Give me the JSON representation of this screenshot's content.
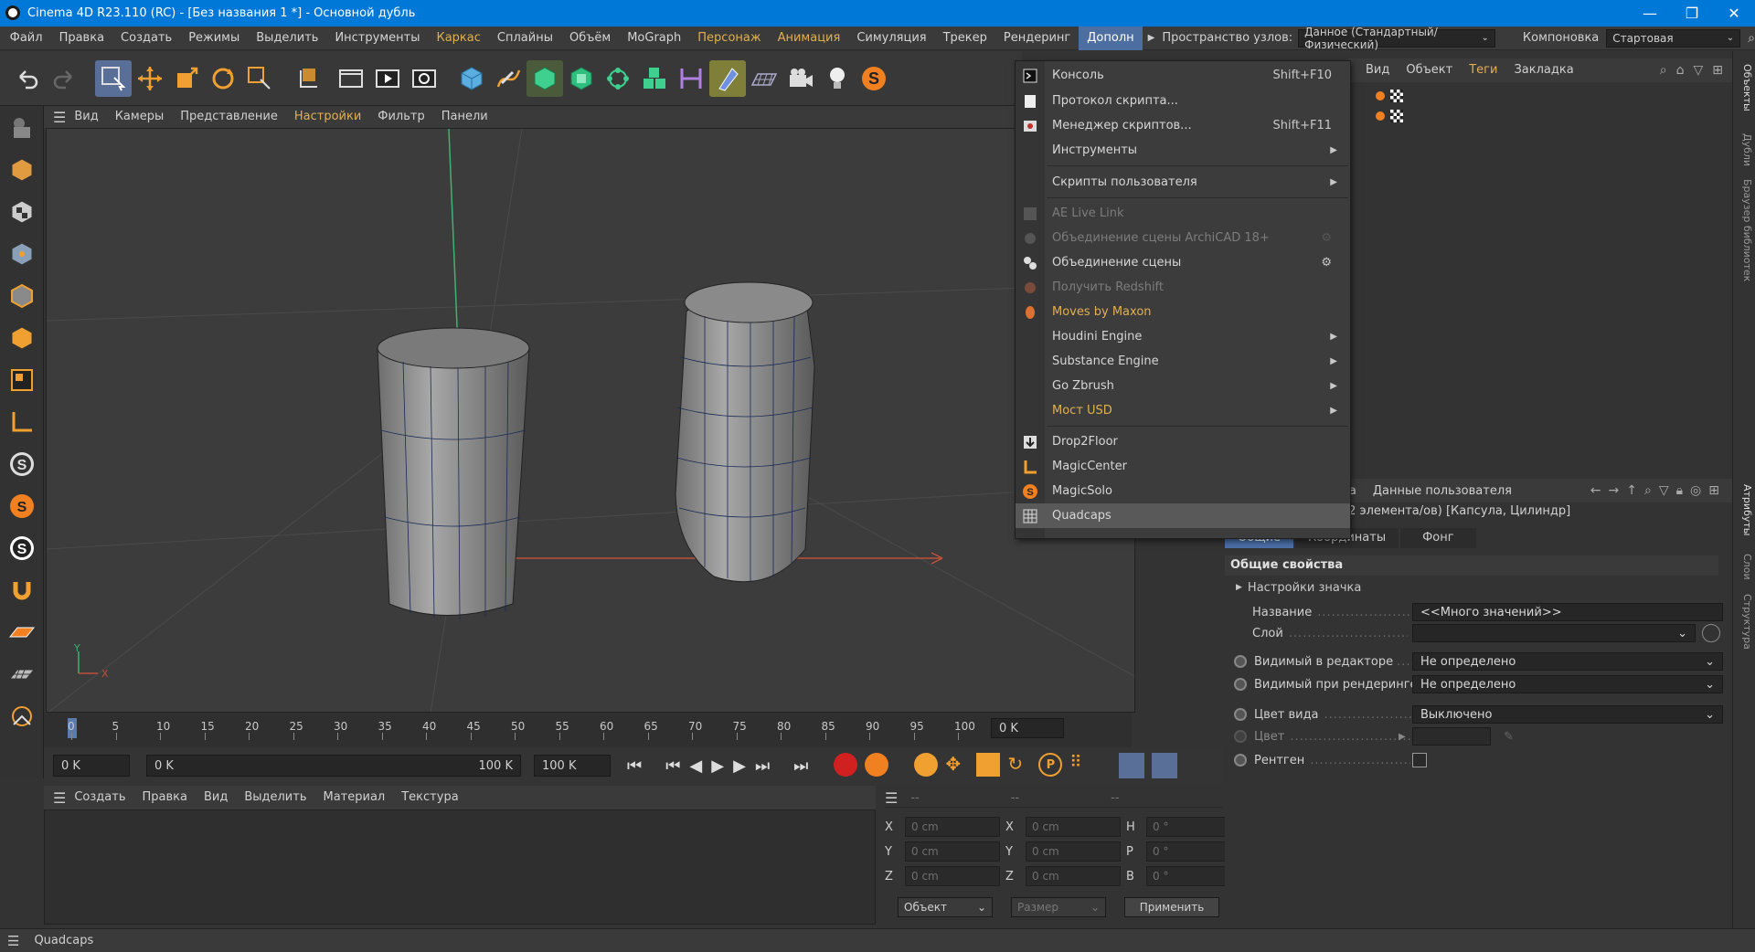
{
  "window": {
    "title": "Cinema 4D R23.110 (RC) - [Без названия 1 *] - Основной дубль",
    "minimize": "—",
    "maximize": "❐",
    "close": "✕"
  },
  "menubar": {
    "items": [
      "Файл",
      "Правка",
      "Создать",
      "Режимы",
      "Выделить",
      "Инструменты",
      "Каркас",
      "Сплайны",
      "Объём",
      "MoGraph",
      "Персонаж",
      "Анимация",
      "Симуляция",
      "Трекер",
      "Рендеринг",
      "Дополн"
    ],
    "node_space_label": "Пространство узлов:",
    "node_space_value": "Данное (Стандартный/Физический)",
    "layout_label": "Компоновка",
    "layout_value": "Стартовая"
  },
  "viewport_menu": {
    "items": [
      "Вид",
      "Камеры",
      "Представление",
      "Настройки",
      "Фильтр",
      "Панели"
    ]
  },
  "axis": {
    "x": "X",
    "y": "Y"
  },
  "timeline": {
    "ticks": [
      "0",
      "5",
      "10",
      "15",
      "20",
      "25",
      "30",
      "35",
      "40",
      "45",
      "50",
      "55",
      "60",
      "65",
      "70",
      "75",
      "80",
      "85",
      "90",
      "95",
      "100"
    ],
    "current_frame": "0 K",
    "start": "0 K",
    "range_start": "0 K",
    "range_end": "100 K",
    "end": "100 K"
  },
  "material_menu": {
    "items": [
      "Создать",
      "Правка",
      "Вид",
      "Выделить",
      "Материал",
      "Текстура"
    ]
  },
  "coords": {
    "header": [
      "--",
      "--",
      "--"
    ],
    "rows": [
      {
        "a": "X",
        "av": "0 cm",
        "b": "X",
        "bv": "0 cm",
        "c": "H",
        "cv": "0 °"
      },
      {
        "a": "Y",
        "av": "0 cm",
        "b": "Y",
        "bv": "0 cm",
        "c": "P",
        "cv": "0 °"
      },
      {
        "a": "Z",
        "av": "0 cm",
        "b": "Z",
        "bv": "0 cm",
        "c": "B",
        "cv": "0 °"
      }
    ],
    "mode": "Объект",
    "size": "Размер",
    "apply": "Применить"
  },
  "status": {
    "text": "Quadcaps"
  },
  "object_manager": {
    "menu": [
      "Вид",
      "Объект",
      "Теги",
      "Закладка"
    ]
  },
  "attributes": {
    "top_left": "ка",
    "user_data": "Данные пользователя",
    "summary": "(2 элемента/ов) [Капсула, Цилиндр]",
    "tabs": [
      "Общие",
      "Координаты",
      "Фонг"
    ],
    "section": "Общие свойства",
    "subsection": "Настройки значка",
    "rows": [
      {
        "label": "Название",
        "value": "<<Много значений>>"
      },
      {
        "label": "Слой",
        "value": ""
      },
      {
        "label": "Видимый в редакторе",
        "value": "Не определено"
      },
      {
        "label": "Видимый при рендеринге",
        "value": "Не определено"
      },
      {
        "label": "Цвет вида",
        "value": "Выключено"
      },
      {
        "label": "Цвет",
        "value": ""
      },
      {
        "label": "Рентген",
        "value": ""
      }
    ]
  },
  "side_tabs": [
    "Объекты",
    "Дубли",
    "Браузер библиотек",
    "Атрибуты",
    "Слои",
    "Структура"
  ],
  "dropdown": {
    "items": [
      {
        "label": "Консоль",
        "shortcut": "Shift+F10"
      },
      {
        "label": "Протокол скрипта..."
      },
      {
        "label": "Менеджер скриптов...",
        "shortcut": "Shift+F11"
      },
      {
        "label": "Инструменты",
        "submenu": true
      },
      {
        "label": "Скрипты пользователя",
        "submenu": true
      },
      {
        "label": "AE Live Link",
        "disabled": true
      },
      {
        "label": "Объединение сцены ArchiCAD 18+",
        "disabled": true
      },
      {
        "label": "Объединение сцены"
      },
      {
        "label": "Получить Redshift",
        "disabled": true
      },
      {
        "label": "Moves by Maxon"
      },
      {
        "label": "Houdini Engine",
        "submenu": true
      },
      {
        "label": "Substance Engine",
        "submenu": true
      },
      {
        "label": "Go Zbrush",
        "submenu": true
      },
      {
        "label": "Мост USD",
        "submenu": true
      },
      {
        "label": "Drop2Floor"
      },
      {
        "label": "MagicCenter"
      },
      {
        "label": "MagicSolo"
      },
      {
        "label": "Quadcaps",
        "highlighted": true
      }
    ]
  },
  "colors": {
    "accent": "#0078d7",
    "gold": "#e0b050",
    "highlight": "#4b6fa8"
  }
}
